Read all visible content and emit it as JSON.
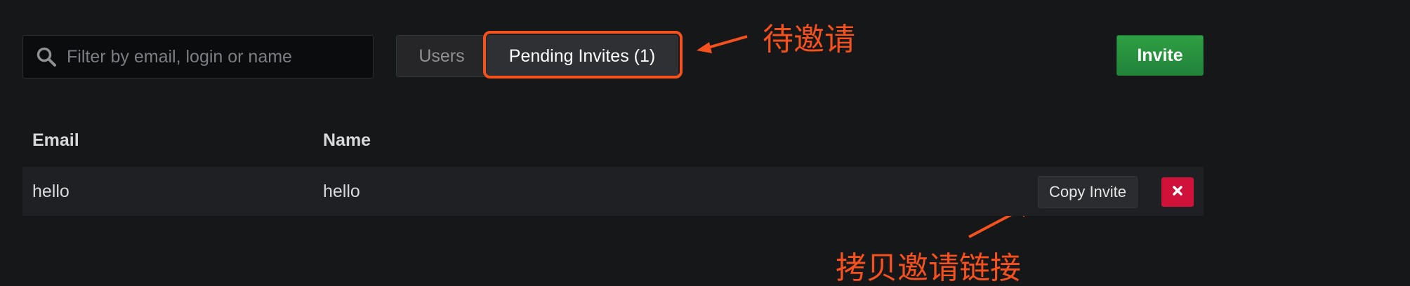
{
  "search": {
    "placeholder": "Filter by email, login or name",
    "value": ""
  },
  "tabs": [
    {
      "label": "Users",
      "active": false
    },
    {
      "label": "Pending Invites (1)",
      "active": true
    }
  ],
  "invite_button": {
    "label": "Invite"
  },
  "table": {
    "columns": [
      "Email",
      "Name"
    ],
    "rows": [
      {
        "email": "hello",
        "name": "hello",
        "copy_label": "Copy Invite"
      }
    ]
  },
  "annotations": {
    "pending_note": "待邀请",
    "copy_note": "拷贝邀请链接"
  },
  "colors": {
    "annotation": "#f4511e",
    "invite_button": "#2ea043",
    "delete_button": "#d0113a",
    "background": "#161719"
  },
  "icons": {
    "search": "search-icon",
    "delete": "close-icon"
  }
}
